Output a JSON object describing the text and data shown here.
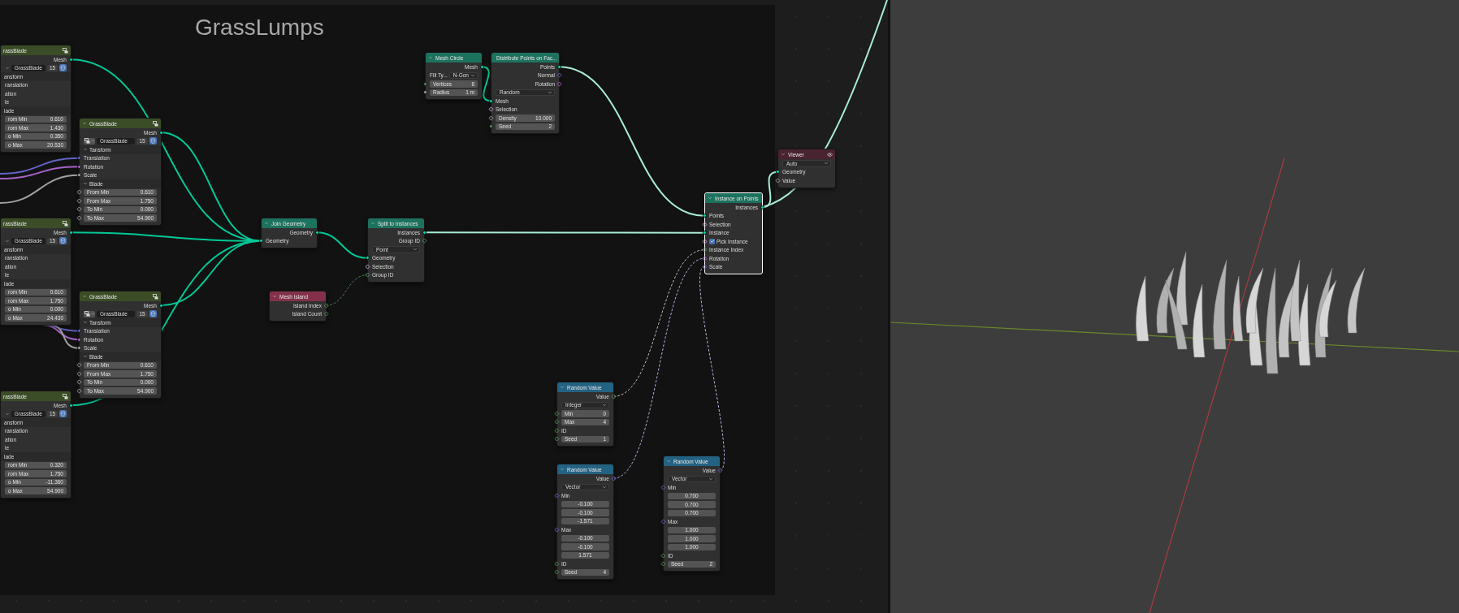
{
  "frame": {
    "title": "GrassLumps"
  },
  "nodes": [
    {
      "title": "rassBlade",
      "color": "#3b4d27",
      "selected": false,
      "cut": true,
      "header_icon": {
        "kind": "group"
      },
      "rows": [
        {
          "kind": "output",
          "label": "Mesh",
          "socket": {
            "kind": "geometry",
            "field": false
          }
        },
        {
          "kind": "datablock",
          "name": "GrassBlade",
          "users": "15"
        },
        {
          "kind": "panel",
          "label": "ansform"
        },
        {
          "kind": "input",
          "label": "ranslation"
        },
        {
          "kind": "input",
          "label": "ation"
        },
        {
          "kind": "input",
          "label": "le"
        },
        {
          "kind": "panel",
          "label": "lade"
        },
        {
          "kind": "field",
          "label": "rom Min",
          "value": "0.610"
        },
        {
          "kind": "field",
          "label": "rom Max",
          "value": "1.430"
        },
        {
          "kind": "field",
          "label": "o Min",
          "value": "0.350"
        },
        {
          "kind": "field",
          "label": "o Max",
          "value": "20.530"
        }
      ]
    },
    {
      "title": "GrassBlade",
      "color": "#3b4d27",
      "selected": false,
      "cut": false,
      "header_icon": {
        "kind": "group"
      },
      "rows": [
        {
          "kind": "output",
          "label": "Mesh",
          "socket": {
            "kind": "geometry",
            "field": false
          }
        },
        {
          "kind": "datablock",
          "name": "GrassBlade",
          "users": "15"
        },
        {
          "kind": "panel",
          "label": "Tansform"
        },
        {
          "kind": "input",
          "label": "Translation",
          "socket": {
            "kind": "vector",
            "field": false
          }
        },
        {
          "kind": "input",
          "label": "Rotation",
          "socket": {
            "kind": "rotation",
            "field": false
          }
        },
        {
          "kind": "input",
          "label": "Scale",
          "socket": {
            "kind": "float",
            "field": false
          }
        },
        {
          "kind": "panel",
          "label": "Blade"
        },
        {
          "kind": "field",
          "label": "From Min",
          "value": "0.610",
          "socket": {
            "kind": "float",
            "field": true
          }
        },
        {
          "kind": "field",
          "label": "From Max",
          "value": "1.750",
          "socket": {
            "kind": "float",
            "field": true
          }
        },
        {
          "kind": "field",
          "label": "To Min",
          "value": "0.000",
          "socket": {
            "kind": "float",
            "field": true
          }
        },
        {
          "kind": "field",
          "label": "To Max",
          "value": "54.900",
          "socket": {
            "kind": "float",
            "field": true
          }
        }
      ]
    },
    {
      "title": "rassBlade",
      "color": "#3b4d27",
      "selected": false,
      "cut": true,
      "header_icon": {
        "kind": "group"
      },
      "rows": [
        {
          "kind": "output",
          "label": "Mesh",
          "socket": {
            "kind": "geometry",
            "field": false
          }
        },
        {
          "kind": "datablock",
          "name": "GrassBlade",
          "users": "15"
        },
        {
          "kind": "panel",
          "label": "ansform"
        },
        {
          "kind": "input",
          "label": "ranslation"
        },
        {
          "kind": "input",
          "label": "ation"
        },
        {
          "kind": "input",
          "label": "le"
        },
        {
          "kind": "panel",
          "label": "lade"
        },
        {
          "kind": "field",
          "label": "rom Min",
          "value": "0.610"
        },
        {
          "kind": "field",
          "label": "rom Max",
          "value": "1.750"
        },
        {
          "kind": "field",
          "label": "o Min",
          "value": "0.000"
        },
        {
          "kind": "field",
          "label": "o Max",
          "value": "24.430"
        }
      ]
    },
    {
      "title": "GrassBlade",
      "color": "#3b4d27",
      "selected": false,
      "cut": false,
      "header_icon": {
        "kind": "group"
      },
      "rows": [
        {
          "kind": "output",
          "label": "Mesh",
          "socket": {
            "kind": "geometry",
            "field": false
          }
        },
        {
          "kind": "datablock",
          "name": "GrassBlade",
          "users": "15"
        },
        {
          "kind": "panel",
          "label": "Tansform"
        },
        {
          "kind": "input",
          "label": "Translation",
          "socket": {
            "kind": "vector",
            "field": false
          }
        },
        {
          "kind": "input",
          "label": "Rotation",
          "socket": {
            "kind": "rotation",
            "field": false
          }
        },
        {
          "kind": "input",
          "label": "Scale",
          "socket": {
            "kind": "float",
            "field": false
          }
        },
        {
          "kind": "panel",
          "label": "Blade"
        },
        {
          "kind": "field",
          "label": "From Min",
          "value": "0.610",
          "socket": {
            "kind": "float",
            "field": true
          }
        },
        {
          "kind": "field",
          "label": "From Max",
          "value": "1.750",
          "socket": {
            "kind": "float",
            "field": true
          }
        },
        {
          "kind": "field",
          "label": "To Min",
          "value": "0.000",
          "socket": {
            "kind": "float",
            "field": true
          }
        },
        {
          "kind": "field",
          "label": "To Max",
          "value": "54.900",
          "socket": {
            "kind": "float",
            "field": true
          }
        }
      ]
    },
    {
      "title": "rassBlade",
      "color": "#3b4d27",
      "selected": false,
      "cut": true,
      "header_icon": {
        "kind": "group"
      },
      "rows": [
        {
          "kind": "output",
          "label": "Mesh",
          "socket": {
            "kind": "geometry",
            "field": false
          }
        },
        {
          "kind": "datablock",
          "name": "GrassBlade",
          "users": "15"
        },
        {
          "kind": "panel",
          "label": "ansform"
        },
        {
          "kind": "input",
          "label": "ranslation"
        },
        {
          "kind": "input",
          "label": "ation"
        },
        {
          "kind": "input",
          "label": "le"
        },
        {
          "kind": "panel",
          "label": "lade"
        },
        {
          "kind": "field",
          "label": "rom Min",
          "value": "0.320"
        },
        {
          "kind": "field",
          "label": "rom Max",
          "value": "1.750"
        },
        {
          "kind": "field",
          "label": "o Min",
          "value": "-11.360"
        },
        {
          "kind": "field",
          "label": "o Max",
          "value": "54.900"
        }
      ]
    },
    {
      "title": "Mesh Circle",
      "color": "#1d725e",
      "selected": false,
      "cut": false,
      "rows": [
        {
          "kind": "output",
          "label": "Mesh",
          "socket": {
            "kind": "geometry",
            "field": false
          }
        },
        {
          "kind": "labeled_dropdown",
          "label": "Fill Ty...",
          "value": "N-Gon"
        },
        {
          "kind": "field",
          "label": "Vertices",
          "value": "8",
          "socket": {
            "kind": "int",
            "field": false
          }
        },
        {
          "kind": "field",
          "label": "Radius",
          "value": "1 m",
          "socket": {
            "kind": "float",
            "field": false
          }
        }
      ]
    },
    {
      "title": "Distribute Points on Fac...",
      "color": "#1d725e",
      "selected": false,
      "cut": false,
      "rows": [
        {
          "kind": "output",
          "label": "Points",
          "socket": {
            "kind": "geometry",
            "field": false
          }
        },
        {
          "kind": "output",
          "label": "Normal",
          "socket": {
            "kind": "vector",
            "field": true
          }
        },
        {
          "kind": "output",
          "label": "Rotation",
          "socket": {
            "kind": "rotation",
            "field": true
          }
        },
        {
          "kind": "dropdown",
          "value": "Random"
        },
        {
          "kind": "input",
          "label": "Mesh",
          "socket": {
            "kind": "geometry",
            "field": false
          }
        },
        {
          "kind": "input",
          "label": "Selection",
          "socket": {
            "kind": "bool",
            "field": true
          }
        },
        {
          "kind": "field",
          "label": "Density",
          "value": "10.000",
          "socket": {
            "kind": "float",
            "field": true
          }
        },
        {
          "kind": "field",
          "label": "Seed",
          "value": "2",
          "socket": {
            "kind": "int",
            "field": false
          }
        }
      ]
    },
    {
      "title": "Join Geometry",
      "color": "#1d725e",
      "selected": false,
      "cut": false,
      "rows": [
        {
          "kind": "output",
          "label": "Geometry",
          "socket": {
            "kind": "geometry",
            "field": false
          }
        },
        {
          "kind": "input",
          "label": "Geometry",
          "socket": {
            "kind": "geometry",
            "field": false
          }
        }
      ]
    },
    {
      "title": "Split to Instances",
      "color": "#1d725e",
      "selected": false,
      "cut": false,
      "rows": [
        {
          "kind": "output",
          "label": "Instances",
          "socket": {
            "kind": "geometry",
            "field": false
          }
        },
        {
          "kind": "output",
          "label": "Group ID",
          "socket": {
            "kind": "int",
            "field": true
          }
        },
        {
          "kind": "dropdown",
          "value": "Point"
        },
        {
          "kind": "input",
          "label": "Geometry",
          "socket": {
            "kind": "geometry",
            "field": false
          }
        },
        {
          "kind": "input",
          "label": "Selection",
          "socket": {
            "kind": "bool",
            "field": true
          }
        },
        {
          "kind": "input",
          "label": "Group ID",
          "socket": {
            "kind": "int",
            "field": true
          }
        }
      ]
    },
    {
      "title": "Mesh Island",
      "color": "#83314a",
      "selected": false,
      "cut": false,
      "rows": [
        {
          "kind": "output",
          "label": "Island Index",
          "socket": {
            "kind": "int",
            "field": true
          }
        },
        {
          "kind": "output",
          "label": "Island Count",
          "socket": {
            "kind": "int",
            "field": true
          }
        }
      ]
    },
    {
      "title": "Instance on Points",
      "color": "#1d725e",
      "selected": true,
      "cut": false,
      "rows": [
        {
          "kind": "output",
          "label": "Instances",
          "socket": {
            "kind": "geometry",
            "field": false
          }
        },
        {
          "kind": "input",
          "label": "Points",
          "socket": {
            "kind": "geometry",
            "field": false
          }
        },
        {
          "kind": "input",
          "label": "Selection",
          "socket": {
            "kind": "bool",
            "field": true
          }
        },
        {
          "kind": "input",
          "label": "Instance",
          "socket": {
            "kind": "geometry",
            "field": false
          }
        },
        {
          "kind": "checkbox",
          "label": "Pick Instance",
          "checked": true,
          "socket": {
            "kind": "bool",
            "field": true
          }
        },
        {
          "kind": "input",
          "label": "Instance Index",
          "socket": {
            "kind": "int",
            "field": true
          }
        },
        {
          "kind": "input",
          "label": "Rotation",
          "socket": {
            "kind": "rotation",
            "field": true
          }
        },
        {
          "kind": "input",
          "label": "Scale",
          "socket": {
            "kind": "vector",
            "field": true
          }
        }
      ]
    },
    {
      "title": "Viewer",
      "color": "#4a2330",
      "selected": false,
      "cut": false,
      "header_icon": {
        "kind": "eye"
      },
      "rows": [
        {
          "kind": "dropdown",
          "value": "Auto"
        },
        {
          "kind": "input",
          "label": "Geometry",
          "socket": {
            "kind": "geometry",
            "field": false
          }
        },
        {
          "kind": "input",
          "label": "Value",
          "socket": {
            "kind": "float",
            "field": true
          }
        }
      ]
    },
    {
      "title": "Random Value",
      "color": "#246283",
      "selected": false,
      "cut": false,
      "rows": [
        {
          "kind": "output",
          "label": "Value",
          "socket": {
            "kind": "int",
            "field": true
          }
        },
        {
          "kind": "dropdown",
          "value": "Integer"
        },
        {
          "kind": "field",
          "label": "Min",
          "value": "0",
          "socket": {
            "kind": "int",
            "field": true
          }
        },
        {
          "kind": "field",
          "label": "Max",
          "value": "4",
          "socket": {
            "kind": "int",
            "field": true
          }
        },
        {
          "kind": "input",
          "label": "ID",
          "socket": {
            "kind": "int",
            "field": true
          }
        },
        {
          "kind": "field",
          "label": "Seed",
          "value": "1",
          "socket": {
            "kind": "int",
            "field": true
          }
        }
      ]
    },
    {
      "title": "Random Value",
      "color": "#246283",
      "selected": false,
      "cut": false,
      "rows": [
        {
          "kind": "output",
          "label": "Value",
          "socket": {
            "kind": "vector",
            "field": true
          }
        },
        {
          "kind": "dropdown",
          "value": "Vector"
        },
        {
          "kind": "input",
          "label": "Min",
          "socket": {
            "kind": "vector",
            "field": true
          }
        },
        {
          "kind": "vector_value",
          "value": "-0.100"
        },
        {
          "kind": "vector_value",
          "value": "-0.100"
        },
        {
          "kind": "vector_value",
          "value": "-1.571"
        },
        {
          "kind": "input",
          "label": "Max",
          "socket": {
            "kind": "vector",
            "field": true
          }
        },
        {
          "kind": "vector_value",
          "value": "-0.100"
        },
        {
          "kind": "vector_value",
          "value": "-0.100"
        },
        {
          "kind": "vector_value",
          "value": "1.571"
        },
        {
          "kind": "input",
          "label": "ID",
          "socket": {
            "kind": "int",
            "field": true
          }
        },
        {
          "kind": "field",
          "label": "Seed",
          "value": "4",
          "socket": {
            "kind": "int",
            "field": true
          }
        }
      ]
    },
    {
      "title": "Random Value",
      "color": "#246283",
      "selected": false,
      "cut": false,
      "rows": [
        {
          "kind": "output",
          "label": "Value",
          "socket": {
            "kind": "vector",
            "field": true
          }
        },
        {
          "kind": "dropdown",
          "value": "Vector"
        },
        {
          "kind": "input",
          "label": "Min",
          "socket": {
            "kind": "vector",
            "field": true
          }
        },
        {
          "kind": "vector_value",
          "value": "0.700"
        },
        {
          "kind": "vector_value",
          "value": "0.700"
        },
        {
          "kind": "vector_value",
          "value": "0.700"
        },
        {
          "kind": "input",
          "label": "Max",
          "socket": {
            "kind": "vector",
            "field": true
          }
        },
        {
          "kind": "vector_value",
          "value": "1.000"
        },
        {
          "kind": "vector_value",
          "value": "1.000"
        },
        {
          "kind": "vector_value",
          "value": "1.000"
        },
        {
          "kind": "input",
          "label": "ID",
          "socket": {
            "kind": "int",
            "field": true
          }
        },
        {
          "kind": "field",
          "label": "Seed",
          "value": "2",
          "socket": {
            "kind": "int",
            "field": true
          }
        }
      ]
    }
  ]
}
